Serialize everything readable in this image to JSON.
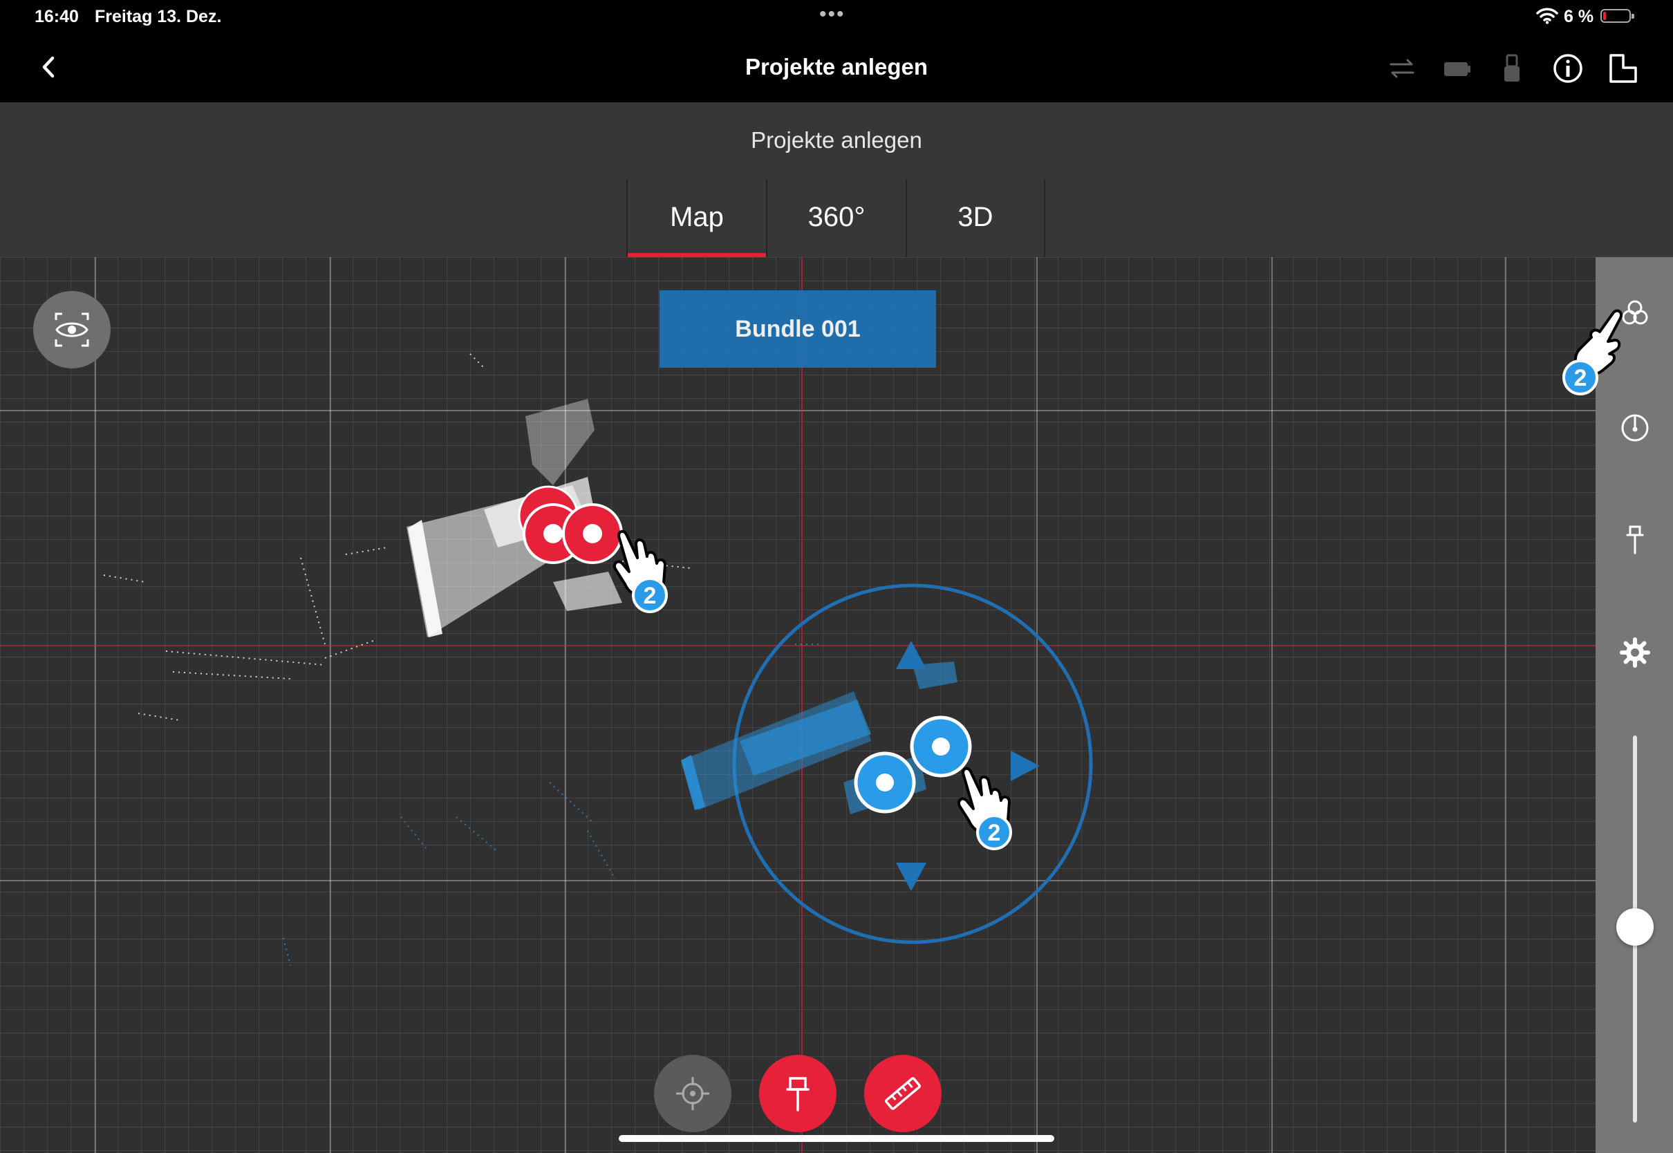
{
  "status": {
    "time": "16:40",
    "date": "Freitag 13. Dez.",
    "battery_pct": "6 %",
    "battery_level": 0.06,
    "accent": "#e8213b"
  },
  "nav": {
    "title": "Projekte anlegen",
    "icons": [
      "back-icon",
      "sync-icon",
      "battery-device-icon",
      "usb-icon",
      "info-icon",
      "floorplan-icon"
    ]
  },
  "subheader": {
    "title": "Projekte anlegen"
  },
  "tabs": [
    {
      "label": "Map",
      "active": true
    },
    {
      "label": "360°"
    },
    {
      "label": "3D"
    }
  ],
  "map": {
    "bundle_label": "Bundle 001",
    "selected_color": "#1f73b7",
    "scan_color": "#e8213b"
  },
  "gesture_hint": {
    "finger_count": "2"
  },
  "sidebar": {
    "icons": [
      "layers-icon",
      "compass-icon",
      "pin-icon",
      "settings-icon"
    ],
    "zoom_level": 0.55
  },
  "fabs": [
    "recenter-icon",
    "add-pin-icon",
    "measure-icon"
  ]
}
